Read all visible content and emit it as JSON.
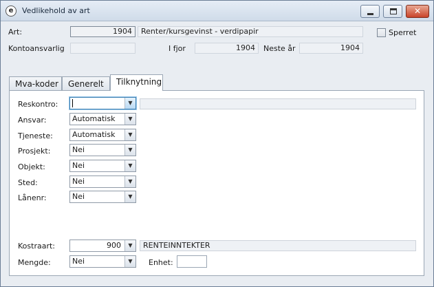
{
  "window": {
    "title": "Vedlikehold av art",
    "app_icon_letter": "e",
    "controls": {
      "minimize": "minimize",
      "maximize": "maximize",
      "close": "✕"
    }
  },
  "header": {
    "art_label": "Art:",
    "art_code": "1904",
    "art_name": "Renter/kursgevinst - verdipapir",
    "kontoansvarlig_label": "Kontoansvarlig",
    "kontoansvarlig_value": "",
    "ifjor_label": "I fjor",
    "ifjor_value": "1904",
    "neste_label": "Neste år",
    "neste_value": "1904",
    "sperret_label": "Sperret",
    "sperret_checked": false
  },
  "tabs": [
    {
      "label": "Mva-koder"
    },
    {
      "label": "Generelt"
    },
    {
      "label": "Tilknytning",
      "active": true
    }
  ],
  "form": {
    "reskontro": {
      "label": "Reskontro:",
      "value": "",
      "description": ""
    },
    "ansvar": {
      "label": "Ansvar:",
      "value": "Automatisk"
    },
    "tjeneste": {
      "label": "Tjeneste:",
      "value": "Automatisk"
    },
    "prosjekt": {
      "label": "Prosjekt:",
      "value": "Nei"
    },
    "objekt": {
      "label": "Objekt:",
      "value": "Nei"
    },
    "sted": {
      "label": "Sted:",
      "value": "Nei"
    },
    "lanenr": {
      "label": "Lånenr:",
      "value": "Nei"
    },
    "kostraart": {
      "label": "Kostraart:",
      "value": "900",
      "description": "RENTEINNTEKTER"
    },
    "mengde": {
      "label": "Mengde:",
      "value": "Nei"
    },
    "enhet": {
      "label": "Enhet:",
      "value": ""
    }
  }
}
